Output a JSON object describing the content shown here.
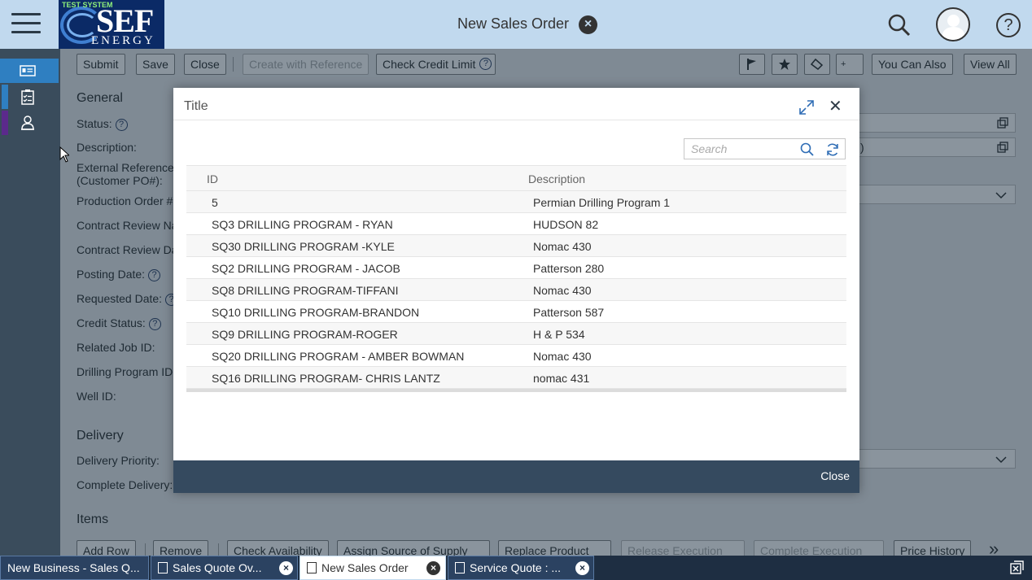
{
  "shell": {
    "title": "New Sales Order",
    "logo_tag": "TEST SYSTEM",
    "logo_main": "SEF",
    "logo_sub": "ENERGY",
    "help": "?"
  },
  "toolbar": {
    "submit": "Submit",
    "save": "Save",
    "close": "Close",
    "create_with_reference": "Create with Reference",
    "check_credit_limit": "Check Credit Limit",
    "you_can_also": "You Can Also",
    "view_all": "View All",
    "plus": "+"
  },
  "form": {
    "general_title": "General",
    "status": "Status:",
    "description": "Description:",
    "external_reference": "External Reference",
    "customer_po": "(Customer PO#):",
    "production_order": "Production Order #",
    "contract_review_name": "Contract Review Na",
    "contract_review_date": "Contract Review Da",
    "posting_date": "Posting Date:",
    "requested_date": "Requested Date:",
    "credit_status": "Credit Status:",
    "related_job_id": "Related Job ID:",
    "drilling_program_id": "Drilling Program ID:",
    "well_id": "Well ID:",
    "delivery_title": "Delivery",
    "delivery_priority": "Delivery Priority:",
    "complete_delivery": "Complete Delivery:",
    "items_title": "Items",
    "right_field_suffix": ")"
  },
  "items_toolbar": {
    "add_row": "Add Row",
    "remove": "Remove",
    "check_availability": "Check Availability",
    "assign_source": "Assign Source of Supply",
    "replace_product": "Replace Product",
    "release_execution": "Release Execution",
    "complete_execution": "Complete Execution",
    "price_history": "Price History",
    "more": "»"
  },
  "dialog": {
    "title": "Title",
    "search_placeholder": "Search",
    "columns": {
      "id": "ID",
      "description": "Description"
    },
    "rows": [
      {
        "id": "5",
        "description": "Permian Drilling Program 1"
      },
      {
        "id": "SQ3 DRILLING PROGRAM - RYAN",
        "description": "HUDSON 82"
      },
      {
        "id": "SQ30 DRILLING PROGRAM -KYLE",
        "description": "Nomac 430"
      },
      {
        "id": "SQ2 DRILLING PROGRAM - JACOB",
        "description": "Patterson 280"
      },
      {
        "id": "SQ8 DRILLING PROGRAM-TIFFANI",
        "description": "Nomac 430"
      },
      {
        "id": "SQ10 DRILLING PROGRAM-BRANDON",
        "description": "Patterson 587"
      },
      {
        "id": "SQ9 DRILLING PROGRAM-ROGER",
        "description": "H & P 534"
      },
      {
        "id": "SQ20 DRILLING PROGRAM - AMBER BOWMAN",
        "description": "Nomac 430"
      },
      {
        "id": "SQ16 DRILLING PROGRAM- CHRIS LANTZ",
        "description": "nomac 431"
      }
    ],
    "close_label": "Close"
  },
  "taskbar": {
    "tabs": [
      {
        "label": "New Business - Sales Q..."
      },
      {
        "label": "Sales Quote Ov..."
      },
      {
        "label": "New Sales Order"
      },
      {
        "label": "Service Quote : ..."
      }
    ]
  },
  "colors": {
    "shell_bg": "#c1d9ee",
    "nav_bg": "#3a4c5c",
    "dialog_footer": "#354a5f",
    "taskbar_bg": "#1e2e42",
    "accent": "#2f7fc1"
  }
}
